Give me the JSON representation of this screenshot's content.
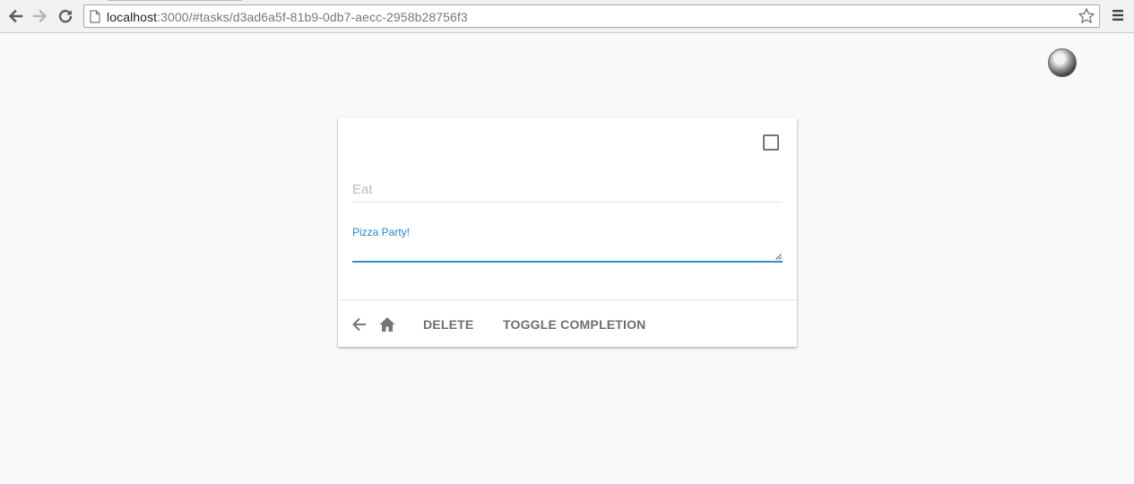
{
  "browser": {
    "url_host": "localhost",
    "url_rest": ":3000/#tasks/d3ad6a5f-81b9-0db7-aecc-2958b28756f3",
    "back_icon": "arrow-left-icon",
    "forward_icon": "arrow-right-icon",
    "reload_icon": "reload-icon",
    "bookmark_icon": "star-icon",
    "menu_icon": "hamburger-menu-icon"
  },
  "header": {
    "avatar_icon": "user-avatar"
  },
  "task": {
    "completed": false,
    "title_placeholder": "Eat",
    "description_label": "Pizza Party!",
    "description_value": ""
  },
  "actions": {
    "back_icon": "arrow-back-icon",
    "home_icon": "home-icon",
    "delete_label": "DELETE",
    "toggle_label": "TOGGLE COMPLETION"
  },
  "colors": {
    "accent": "#1e88e5",
    "background": "#f9f9f9",
    "action_text": "#6e6e6e"
  }
}
